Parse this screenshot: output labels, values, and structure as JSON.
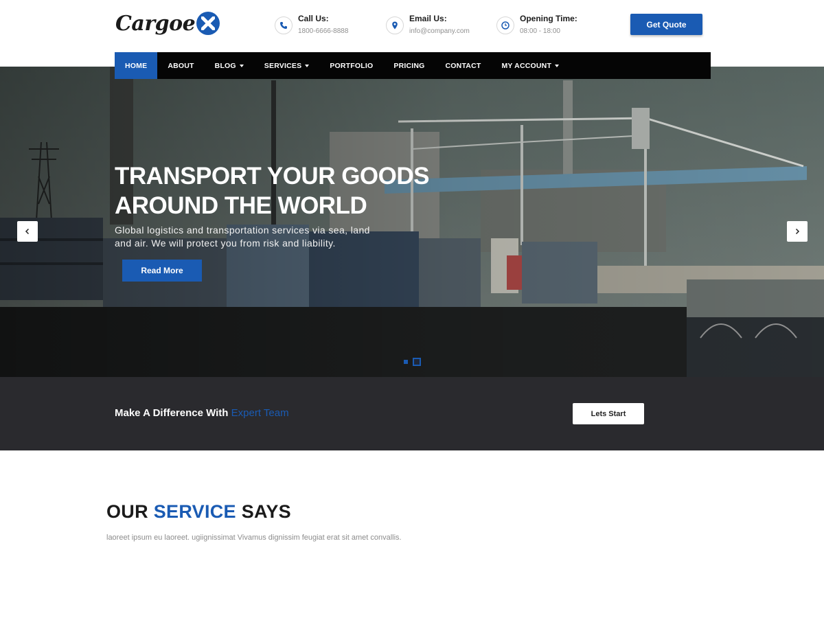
{
  "header": {
    "logo_text": "Cargoe",
    "contacts": [
      {
        "label": "Call Us:",
        "value": "1800-6666-8888",
        "icon": "phone-icon"
      },
      {
        "label": "Email Us:",
        "value": "info@company.com",
        "icon": "map-pin-icon"
      },
      {
        "label": "Opening Time:",
        "value": "08:00 - 18:00",
        "icon": "clock-icon"
      }
    ],
    "quote_button": "Get Quote"
  },
  "nav": {
    "items": [
      {
        "label": "HOME",
        "active": true,
        "dropdown": false
      },
      {
        "label": "ABOUT",
        "active": false,
        "dropdown": false
      },
      {
        "label": "BLOG",
        "active": false,
        "dropdown": true
      },
      {
        "label": "SERVICES",
        "active": false,
        "dropdown": true
      },
      {
        "label": "PORTFOLIO",
        "active": false,
        "dropdown": false
      },
      {
        "label": "PRICING",
        "active": false,
        "dropdown": false
      },
      {
        "label": "CONTACT",
        "active": false,
        "dropdown": false
      },
      {
        "label": "MY ACCOUNT",
        "active": false,
        "dropdown": true
      }
    ]
  },
  "hero": {
    "title_line1": "TRANSPORT YOUR GOODS",
    "title_line2": "AROUND THE WORLD",
    "subtitle_line1": "Global logistics and transportation services via sea, land",
    "subtitle_line2": "and air. We will protect you from risk and liability.",
    "button": "Read More",
    "slides": 2,
    "active_slide": 2
  },
  "cta": {
    "text": "Make A Difference With",
    "highlight": "Expert Team",
    "button": "Lets Start"
  },
  "service": {
    "title_part1": "OUR",
    "title_highlight": "SERVICE",
    "title_part2": "SAYS",
    "description": "laoreet ipsum eu laoreet. ugiignissimat Vivamus dignissim feugiat erat sit amet convallis."
  },
  "colors": {
    "accent": "#1a5bb3",
    "nav_bg": "#050505",
    "cta_bg": "#2a2a2e"
  }
}
